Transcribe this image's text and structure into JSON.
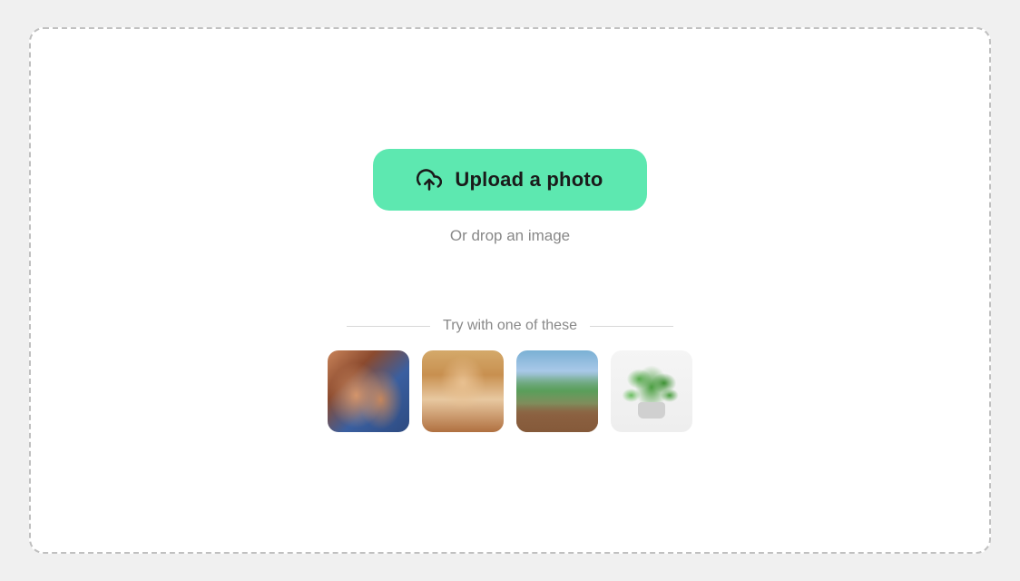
{
  "dropzone": {
    "upload_button_label": "Upload a photo",
    "drop_hint": "Or drop an image",
    "samples_label": "Try with one of these",
    "upload_icon": "upload-icon",
    "samples": [
      {
        "id": "sample-1",
        "description": "Two people selfie"
      },
      {
        "id": "sample-2",
        "description": "Portrait of a woman"
      },
      {
        "id": "sample-3",
        "description": "Mountain cabin landscape"
      },
      {
        "id": "sample-4",
        "description": "Potted plant"
      }
    ]
  }
}
